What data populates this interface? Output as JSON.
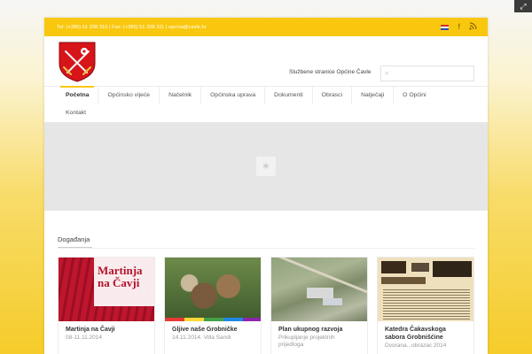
{
  "topbar": {
    "contact": "Tel: (+385) 51 208 310 | Fax: (+385) 51 208 311 | opcina@cavle.hr",
    "icons": [
      "english-flag-icon",
      "facebook-icon",
      "rss-icon"
    ]
  },
  "header": {
    "site_label": "Službene stranice Općine Čavle",
    "search_placeholder": ""
  },
  "nav": {
    "items": [
      "Početna",
      "Općinsko vijeće",
      "Načelnik",
      "Općinska uprava",
      "Dokumenti",
      "Obrasci",
      "Natječaji",
      "O Općini"
    ],
    "items_row2": [
      "Kontakt"
    ],
    "active": "Početna"
  },
  "section": {
    "title": "Događanja"
  },
  "cards": [
    {
      "thumb_text": "Martinja na Čavji",
      "title": "Martinja na Čavji",
      "meta": "08-11.11.2014"
    },
    {
      "title": "Gljive naše Grobničke",
      "meta": "14.11.2014. Villa Sandi"
    },
    {
      "title": "Plan ukupnog razvoja",
      "meta": "Prikupljanje projektnih prijedloga"
    },
    {
      "title": "Katedra Čakavskoga sabora Grobnišćine",
      "meta": "Dvorana...obrazac 2014"
    }
  ],
  "colors": {
    "accent": "#f9c80e",
    "crest_red": "#d7141a"
  }
}
